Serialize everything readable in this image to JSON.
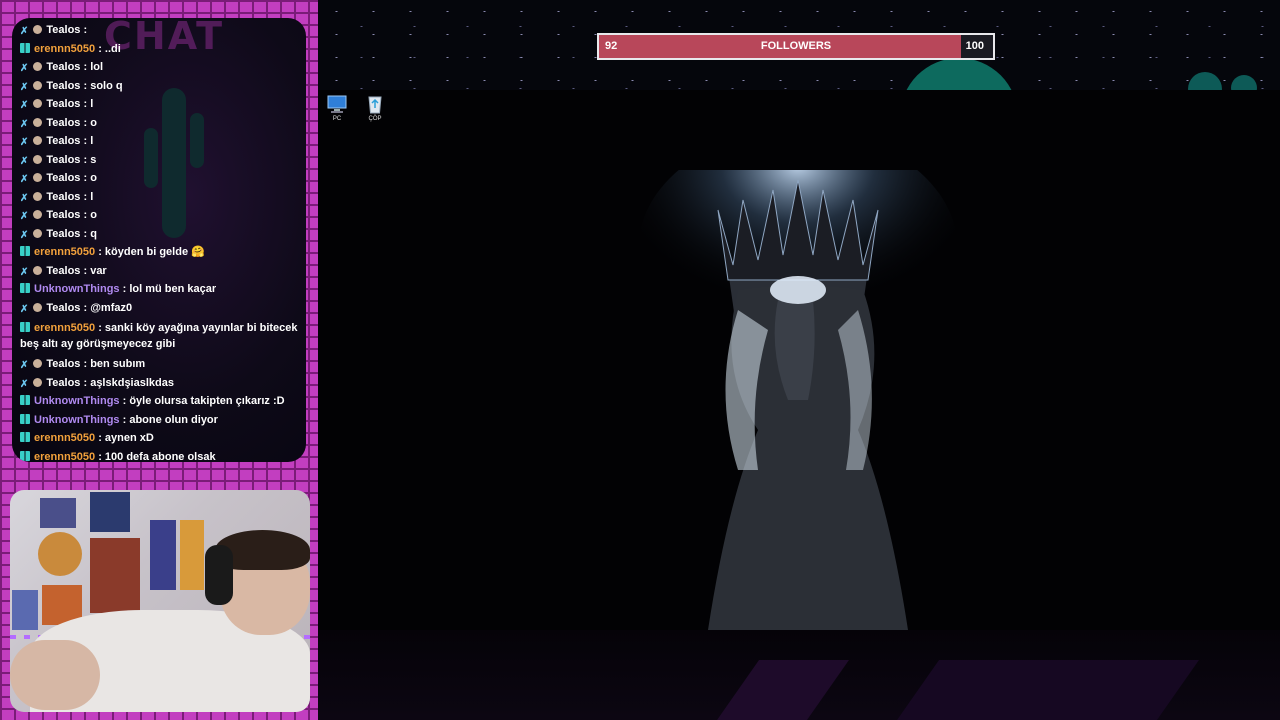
{
  "chat": {
    "watermark": "CHAT",
    "messages": [
      {
        "badge": "sword",
        "user": "Tealos",
        "user_class": "u-tealos",
        "text": " : "
      },
      {
        "badge": "grid",
        "user": "erennn5050",
        "user_class": "u-eren",
        "text": " : ..di"
      },
      {
        "badge": "sword",
        "user": "Tealos",
        "user_class": "u-tealos",
        "text": " : lol"
      },
      {
        "badge": "sword",
        "user": "Tealos",
        "user_class": "u-tealos",
        "text": " : solo q"
      },
      {
        "badge": "sword",
        "user": "Tealos",
        "user_class": "u-tealos",
        "text": " : l"
      },
      {
        "badge": "sword",
        "user": "Tealos",
        "user_class": "u-tealos",
        "text": " : o"
      },
      {
        "badge": "sword",
        "user": "Tealos",
        "user_class": "u-tealos",
        "text": " : l"
      },
      {
        "badge": "sword",
        "user": "Tealos",
        "user_class": "u-tealos",
        "text": " : s"
      },
      {
        "badge": "sword",
        "user": "Tealos",
        "user_class": "u-tealos",
        "text": " : o"
      },
      {
        "badge": "sword",
        "user": "Tealos",
        "user_class": "u-tealos",
        "text": " : l"
      },
      {
        "badge": "sword",
        "user": "Tealos",
        "user_class": "u-tealos",
        "text": " : o"
      },
      {
        "badge": "sword",
        "user": "Tealos",
        "user_class": "u-tealos",
        "text": " : q"
      },
      {
        "badge": "grid",
        "user": "erennn5050",
        "user_class": "u-eren",
        "text": " : köyden bi gelde 🤗"
      },
      {
        "badge": "sword",
        "user": "Tealos",
        "user_class": "u-tealos",
        "text": " : var"
      },
      {
        "badge": "grid",
        "user": "UnknownThings",
        "user_class": "u-unknown",
        "text": " : lol mü ben kaçar"
      },
      {
        "badge": "sword",
        "user": "Tealos",
        "user_class": "u-tealos",
        "text": " : @mfaz0"
      },
      {
        "badge": "grid",
        "user": "erennn5050",
        "user_class": "u-eren",
        "text": " : sanki köy ayağına yayınlar bi bitecek beş altı ay görüşmeyecez gibi",
        "wrap": true
      },
      {
        "badge": "sword",
        "user": "Tealos",
        "user_class": "u-tealos",
        "text": " : ben subım"
      },
      {
        "badge": "sword",
        "user": "Tealos",
        "user_class": "u-tealos",
        "text": " : aşlskdşiaslkdas"
      },
      {
        "badge": "grid",
        "user": "UnknownThings",
        "user_class": "u-unknown",
        "text": " : öyle olursa takipten çıkarız :D"
      },
      {
        "badge": "grid",
        "user": "UnknownThings",
        "user_class": "u-unknown",
        "text": " : abone olun diyor"
      },
      {
        "badge": "grid",
        "user": "erennn5050",
        "user_class": "u-eren",
        "text": " : aynen xD"
      },
      {
        "badge": "grid",
        "user": "erennn5050",
        "user_class": "u-eren",
        "text": " : 100 defa abone olsak"
      }
    ]
  },
  "followers_goal": {
    "current": "92",
    "title": "FOLLOWERS",
    "goal": "100",
    "progress": 0.92,
    "fill_color": "#b8475a"
  },
  "desktop_icons": [
    {
      "label": "PC",
      "icon": "computer-icon"
    },
    {
      "label": "ÇÖP",
      "icon": "recycle-bin-icon"
    }
  ],
  "colors": {
    "frame": "#c23ec0",
    "tealos": "#ffffff",
    "erennn5050": "#f2a13c",
    "unknownthings": "#b08af0"
  }
}
